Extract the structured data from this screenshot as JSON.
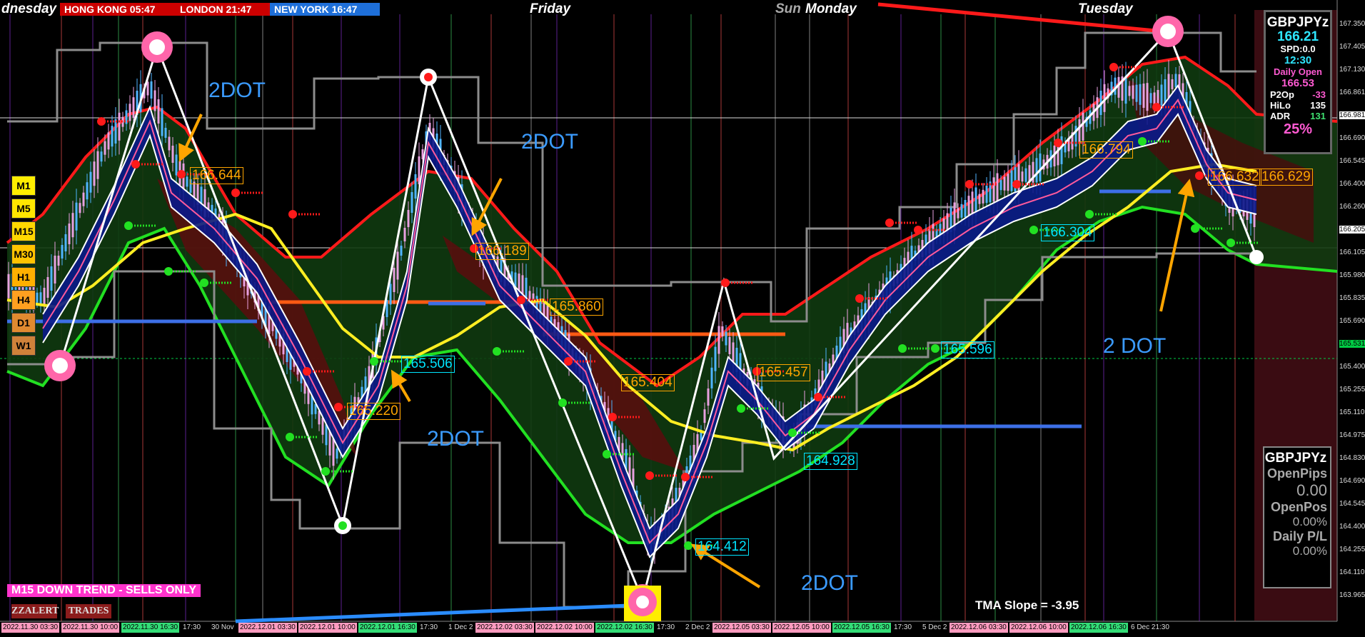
{
  "header": {
    "partial_day": "dnesday",
    "clocks": [
      {
        "label": "HONG KONG 05:47",
        "color": "#cc0000"
      },
      {
        "label": "LONDON  21:47",
        "color": "#cc0000"
      },
      {
        "label": "NEW YORK 16:47",
        "color": "#1e6fd9"
      }
    ],
    "days": [
      {
        "text": "Friday"
      },
      {
        "text": "Sun"
      },
      {
        "text": "Monday"
      },
      {
        "text": "Tuesday"
      }
    ]
  },
  "timeframes": [
    {
      "label": "M1",
      "color": "#ffee00"
    },
    {
      "label": "M5",
      "color": "#ffe600"
    },
    {
      "label": "M15",
      "color": "#ffd700"
    },
    {
      "label": "M30",
      "color": "#ffc400"
    },
    {
      "label": "H1",
      "color": "#ffb000"
    },
    {
      "label": "H4",
      "color": "#ffa020"
    },
    {
      "label": "D1",
      "color": "#e08a30"
    },
    {
      "label": "W1",
      "color": "#d0823a"
    }
  ],
  "dot_labels": [
    "2DOT",
    "2DOT",
    "2DOT",
    "2DOT",
    "2 DOT"
  ],
  "price_labels": [
    {
      "text": "166.644",
      "color": "#ffa500"
    },
    {
      "text": "166.189",
      "color": "#ffa500"
    },
    {
      "text": "165.860",
      "color": "#ffa500"
    },
    {
      "text": "165.506",
      "color": "#00e5ff"
    },
    {
      "text": "165.220",
      "color": "#ffa500"
    },
    {
      "text": "165.404",
      "color": "#ffa500"
    },
    {
      "text": "165.457",
      "color": "#ffa500"
    },
    {
      "text": "164.928",
      "color": "#00e5ff"
    },
    {
      "text": "164.412",
      "color": "#00e5ff"
    },
    {
      "text": "165.596",
      "color": "#00e5ff"
    },
    {
      "text": "166.304",
      "color": "#00e5ff"
    },
    {
      "text": "166.794",
      "color": "#ffa500"
    },
    {
      "text": "166.632",
      "color": "#ffa500"
    },
    {
      "text": "166.629",
      "color": "#ffa500"
    }
  ],
  "info_panel": {
    "symbol": "GBPJPYz",
    "price": "166.21",
    "spread": "SPD:0.0",
    "time": "12:30",
    "daily_open_label": "Daily Open",
    "daily_open": "166.53",
    "p2op_label": "P2Op",
    "p2op": "-33",
    "hilo_label": "HiLo",
    "hilo": "135",
    "adr_label": "ADR",
    "adr": "131",
    "percent": "25%"
  },
  "account_panel": {
    "symbol": "GBPJPYz",
    "open_pips_label": "OpenPips",
    "open_pips": "0.00",
    "open_pos_label": "OpenPos",
    "open_pos": "0.00%",
    "daily_pl_label": "Daily P/L",
    "daily_pl": "0.00%"
  },
  "status": {
    "trend": "M15  DOWN TREND - SELLS ONLY",
    "zzalert": "ZZALERT",
    "trades": "TRADES",
    "tma_slope": "TMA Slope = -3.95"
  },
  "price_axis": [
    "167.350",
    "167.405",
    "167.130",
    "166.861",
    "166.981",
    "166.690",
    "166.545",
    "166.400",
    "166.260",
    "166.205",
    "166.105",
    "165.980",
    "165.835",
    "165.690",
    "165.531",
    "165.400",
    "165.255",
    "165.110",
    "164.975",
    "164.830",
    "164.690",
    "164.545",
    "164.400",
    "164.255",
    "164.110",
    "163.965"
  ],
  "price_axis_highlight": [
    {
      "text": "166.981",
      "bg": "#ffffff"
    },
    {
      "text": "166.205",
      "bg": "#ffffff"
    },
    {
      "text": "165.531",
      "bg": "#00cc44"
    }
  ],
  "time_axis": [
    {
      "text": "2022.11.30 03:30",
      "bg": "#ff9bbf"
    },
    {
      "text": "2022.11.30 10:00",
      "bg": "#ff9bbf"
    },
    {
      "text": "2022.11.30 16:30",
      "bg": "#33dd77"
    },
    {
      "text": "17:30",
      "bg": ""
    },
    {
      "text": "30 Nov",
      "bg": ""
    },
    {
      "text": "2022.12.01 03:30",
      "bg": "#ff9bbf"
    },
    {
      "text": "2022.12.01 10:00",
      "bg": "#ff9bbf"
    },
    {
      "text": "2022.12.01 16:30",
      "bg": "#33dd77"
    },
    {
      "text": "17:30",
      "bg": ""
    },
    {
      "text": "1 Dec 2",
      "bg": ""
    },
    {
      "text": "2022.12.02 03:30",
      "bg": "#ff9bbf"
    },
    {
      "text": "2022.12.02 10:00",
      "bg": "#ff9bbf"
    },
    {
      "text": "2022.12.02 16:30",
      "bg": "#33dd77"
    },
    {
      "text": "17:30",
      "bg": ""
    },
    {
      "text": "2 Dec 2",
      "bg": ""
    },
    {
      "text": "2022.12.05 03:30",
      "bg": "#ff9bbf"
    },
    {
      "text": "2022.12.05 10:00",
      "bg": "#ff9bbf"
    },
    {
      "text": "2022.12.05 16:30",
      "bg": "#33dd77"
    },
    {
      "text": "17:30",
      "bg": ""
    },
    {
      "text": "5 Dec 2",
      "bg": ""
    },
    {
      "text": "2022.12.06 03:30",
      "bg": "#ff9bbf"
    },
    {
      "text": "2022.12.06 10:00",
      "bg": "#ff9bbf"
    },
    {
      "text": "2022.12.06 16:30",
      "bg": "#33dd77"
    },
    {
      "text": "6 Dec 21:30",
      "bg": ""
    }
  ]
}
